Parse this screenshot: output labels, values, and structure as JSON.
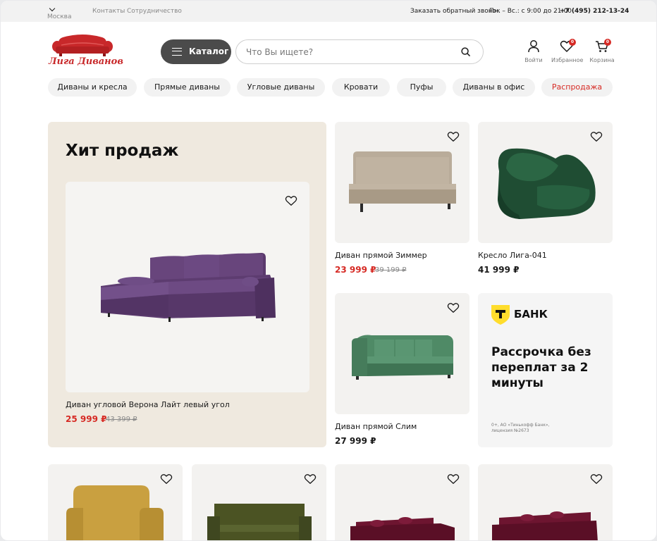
{
  "topbar": {
    "city": "Москва",
    "links": [
      "Контакты",
      "Сотрудничество"
    ],
    "callback": "Заказать обратный звонок",
    "hours": "Пн. – Вс.: с 9:00 до 21:00",
    "phone": "+7 (495) 212-13-24"
  },
  "header": {
    "logo_text": "Лига Диванов",
    "catalog_label": "Каталог",
    "search_placeholder": "Что Вы ищете?",
    "icons": [
      {
        "name": "user-icon",
        "label": "Войти"
      },
      {
        "name": "heart-icon",
        "label": "Избранное",
        "badge": "0"
      },
      {
        "name": "cart-icon",
        "label": "Корзина",
        "badge": "0"
      }
    ]
  },
  "categories": [
    "Диваны и кресла",
    "Прямые диваны",
    "Угловые диваны",
    "Кровати",
    "Пуфы",
    "Диваны в офис",
    "Распродажа"
  ],
  "hero": {
    "title": "Хит продаж",
    "product": {
      "name": "Диван угловой Верона Лайт левый угол",
      "price": "25 999 ₽",
      "old_price": "43 399 ₽"
    }
  },
  "products": [
    {
      "name": "Диван прямой Зиммер",
      "price": "23 999 ₽",
      "old_price": "39 199 ₽"
    },
    {
      "name": "Кресло Лига-041",
      "price": "41 999 ₽"
    },
    {
      "name": "Диван прямой Слим",
      "price": "27 999 ₽"
    }
  ],
  "bank": {
    "name": "БАНК",
    "promo": "Рассрочка без переплат за 2 минуты",
    "fine_print": "0+, АО «Тинькофф Банк», лицензия №2673"
  },
  "colors": {
    "accent": "#d62a24",
    "dark_button": "#4b4b4b",
    "hero_bg": "#efe9df",
    "bank_yellow": "#ffdd2d"
  }
}
